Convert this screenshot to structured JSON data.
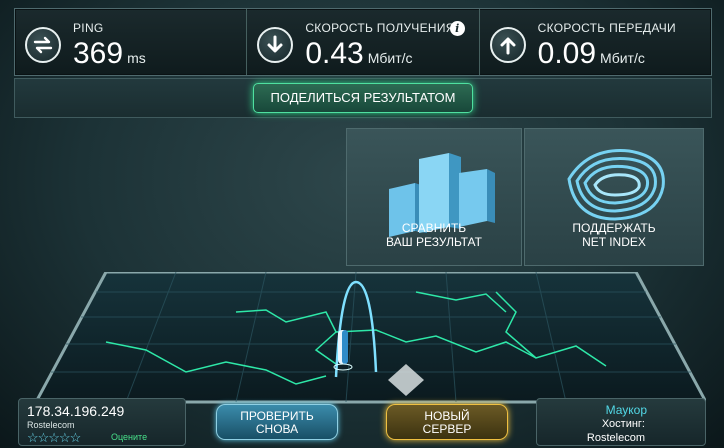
{
  "stats": {
    "ping": {
      "label": "PING",
      "value": "369",
      "unit": "ms"
    },
    "download": {
      "label": "СКОРОСТЬ ПОЛУЧЕНИЯ",
      "value": "0.43",
      "unit": "Мбит/с"
    },
    "upload": {
      "label": "СКОРОСТЬ ПЕРЕДАЧИ",
      "value": "0.09",
      "unit": "Мбит/с"
    }
  },
  "share_button": "ПОДЕЛИТЬСЯ РЕЗУЛЬТАТОМ",
  "tiles": {
    "compare": {
      "line1": "СРАВНИТЬ",
      "line2": "ВАШ РЕЗУЛЬТАТ"
    },
    "support": {
      "line1": "ПОДДЕРЖАТЬ",
      "line2": "NET INDEX"
    }
  },
  "client": {
    "ip": "178.34.196.249",
    "isp": "Rostelecom",
    "rate_label": "Оцените",
    "stars": "☆☆☆☆☆"
  },
  "buttons": {
    "retest": {
      "line1": "ПРОВЕРИТЬ",
      "line2": "СНОВА"
    },
    "new_server": {
      "line1": "НОВЫЙ",
      "line2": "СЕРВЕР"
    }
  },
  "server": {
    "city": "Маукор",
    "host_label": "Хостинг:",
    "host_name": "Rostelecom"
  },
  "colors": {
    "accent_green": "#33d78c",
    "accent_blue": "#5fc8e8",
    "accent_gold": "#f2c23e",
    "map_line": "#2ee8a8"
  }
}
